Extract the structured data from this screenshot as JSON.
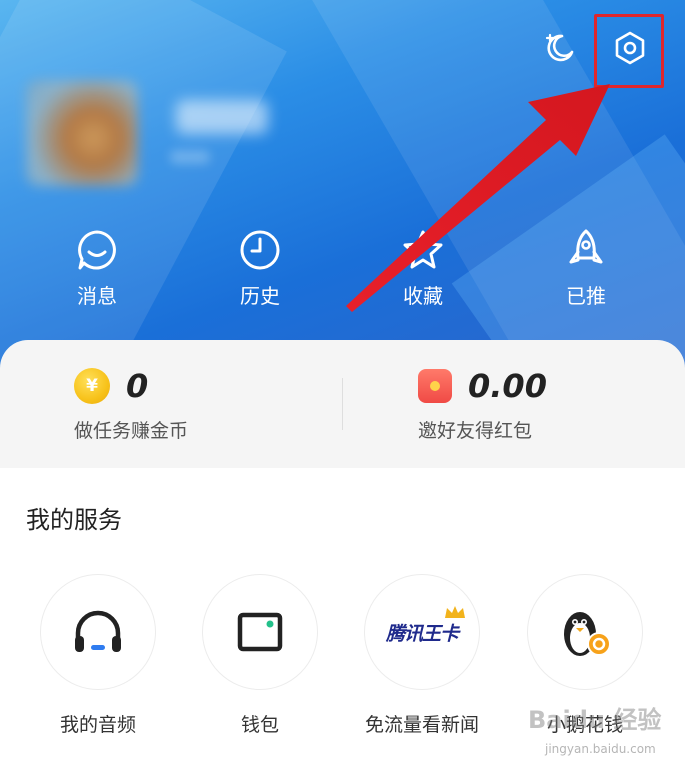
{
  "header": {
    "quick_actions": [
      {
        "label": "消息",
        "icon": "message-icon"
      },
      {
        "label": "历史",
        "icon": "clock-icon"
      },
      {
        "label": "收藏",
        "icon": "star-icon"
      },
      {
        "label": "已推",
        "icon": "rocket-icon"
      }
    ],
    "top_icons": [
      "night-mode-icon",
      "settings-icon"
    ]
  },
  "earnings": {
    "coins": {
      "value": "0",
      "label": "做任务赚金币",
      "icon": "coin-icon"
    },
    "red_packet": {
      "value": "0.00",
      "label": "邀好友得红包",
      "icon": "red-packet-icon"
    }
  },
  "services": {
    "title": "我的服务",
    "items": [
      {
        "label": "我的音频",
        "icon": "headphones-icon"
      },
      {
        "label": "钱包",
        "icon": "wallet-icon"
      },
      {
        "label": "免流量看新闻",
        "icon": "tencent-king-card-icon",
        "logo_text": "腾讯王卡"
      },
      {
        "label": "小鹅花钱",
        "icon": "penguin-coin-icon"
      }
    ]
  },
  "watermark": {
    "text": "Baidu 经验",
    "url": "jingyan.baidu.com"
  },
  "colors": {
    "header_blue": "#1a6fd8",
    "highlight_red": "#e0262c",
    "coin_gold": "#f7c21a",
    "red_packet": "#f04a45"
  }
}
